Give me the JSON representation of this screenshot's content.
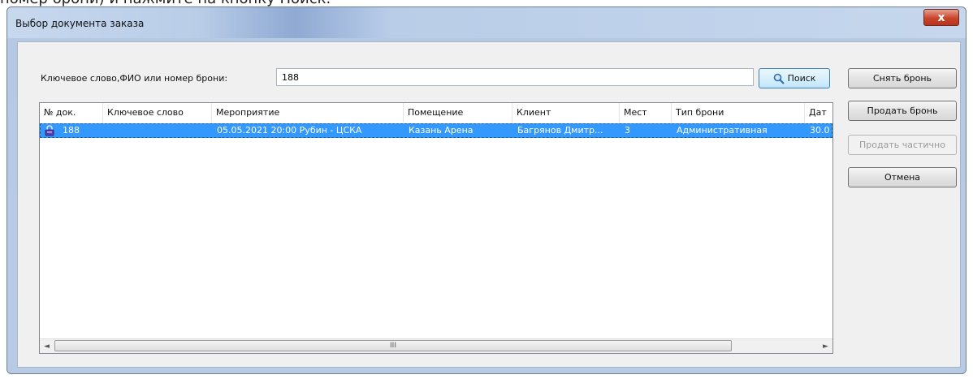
{
  "top_caption": "номер брони) и нажмите на кнопку Поиск.",
  "window": {
    "title": "Выбор документа заказа",
    "close_symbol": "x"
  },
  "search": {
    "label": "Ключевое слово,ФИО или номер брони:",
    "value": "188",
    "button": "Поиск"
  },
  "buttons": {
    "remove_reservation": "Снять бронь",
    "sell_reservation": "Продать бронь",
    "sell_partial": "Продать частично",
    "cancel": "Отмена"
  },
  "table": {
    "columns": [
      "№ док.",
      "Ключевое слово",
      "Мероприятие",
      "Помещение",
      "Клиент",
      "Мест",
      "Тип брони",
      "Дат"
    ],
    "rows": [
      {
        "cells": [
          "188",
          "",
          "05.05.2021 20:00 Рубин - ЦСКА",
          "Казань Арена",
          "Багрянов Дмитр...",
          "3",
          "Административная",
          "30.0"
        ],
        "icon": "lock-icon",
        "selected": true
      }
    ]
  },
  "scrollbar": {
    "grip": "III",
    "left": "◄",
    "right": "►"
  },
  "colors": {
    "selection": "#3399ff",
    "window_frame": "#b9cbe4",
    "close": "#c8452c"
  }
}
